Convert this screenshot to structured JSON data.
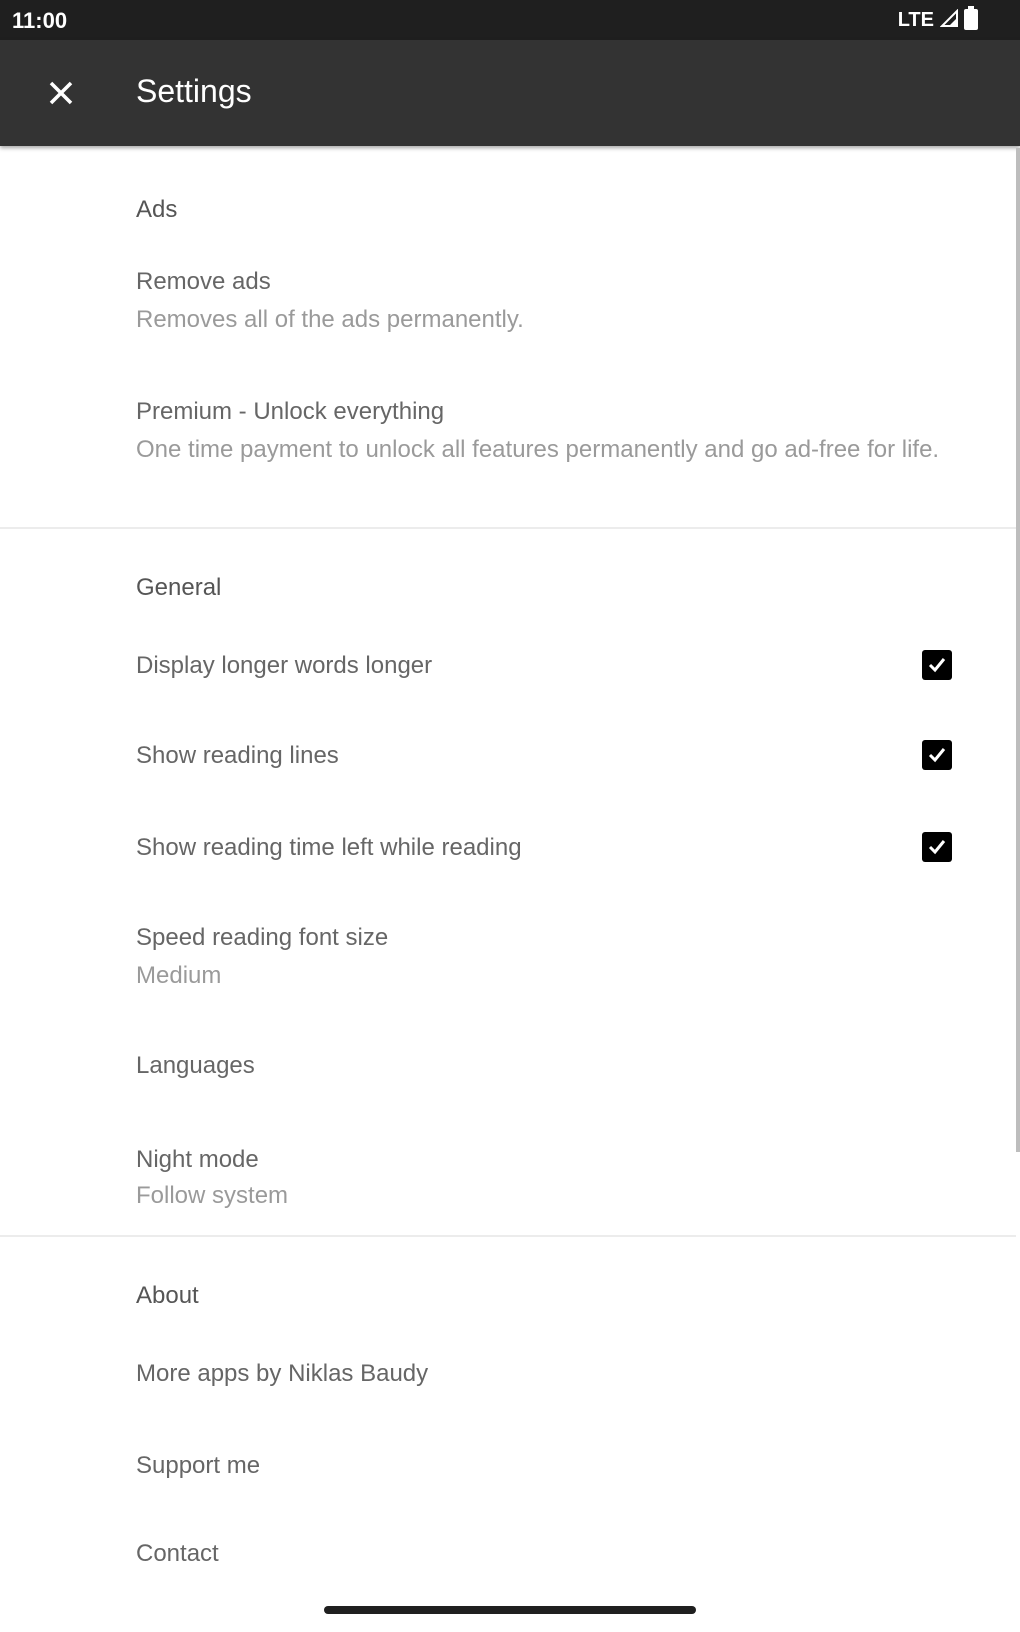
{
  "status_bar": {
    "time": "11:00",
    "network": "LTE"
  },
  "toolbar": {
    "title": "Settings",
    "close_icon": "close-icon"
  },
  "ads": {
    "header": "Ads",
    "remove_ads": {
      "title": "Remove ads",
      "summary": "Removes all of the ads permanently."
    },
    "premium": {
      "title": "Premium - Unlock everything",
      "summary": "One time payment to unlock all features permanently and go ad-free for life."
    }
  },
  "general": {
    "header": "General",
    "display_longer": {
      "title": "Display longer words longer",
      "checked": true
    },
    "reading_lines": {
      "title": "Show reading lines",
      "checked": true
    },
    "reading_time": {
      "title": "Show reading time left while reading",
      "checked": true
    },
    "font_size": {
      "title": "Speed reading font size",
      "summary": "Medium"
    },
    "languages": {
      "title": "Languages"
    },
    "night_mode": {
      "title": "Night mode",
      "summary": "Follow system"
    }
  },
  "about": {
    "header": "About",
    "more_apps": {
      "title": "More apps by Niklas Baudy"
    },
    "support": {
      "title": "Support me"
    },
    "contact": {
      "title": "Contact"
    }
  },
  "colors": {
    "toolbar": "#333333",
    "status_bar": "#1f1f1f",
    "checkbox": "#000000"
  }
}
